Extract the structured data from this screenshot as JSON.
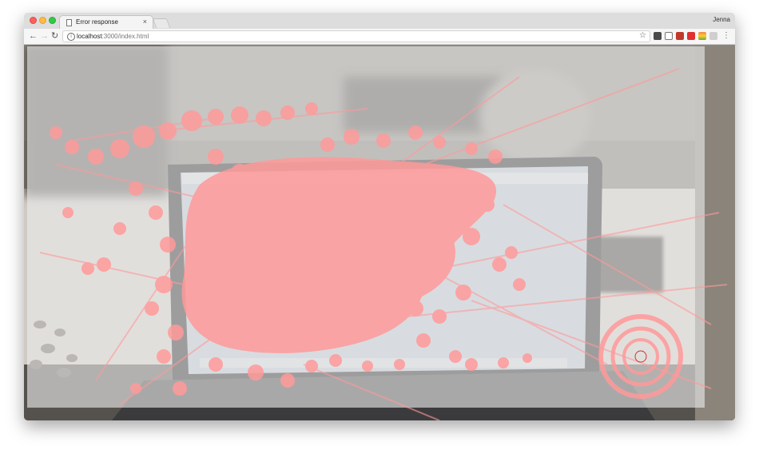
{
  "browser": {
    "tab_title": "Error response",
    "tab_close": "×",
    "profile_name": "Jenna",
    "url_host": "localhost",
    "url_path": ":3000/index.html",
    "nav": {
      "back": "←",
      "forward": "→",
      "reload": "↻"
    },
    "star": "☆",
    "menu": "⋮",
    "extension_icons": [
      "evernote-icon",
      "bookmark-icon",
      "shield-icon",
      "pdf-icon",
      "color-icon",
      "extension-icon"
    ]
  },
  "colors": {
    "gaze_overlay": "#ff9a9a",
    "target_ring": "#ff9999",
    "target_center": "#cc3333",
    "frost_overlay": "#ececec"
  },
  "overlay": {
    "content": "webcam video frame of a laptop with an eye-gaze heatmap overlay and a concentric-ring gaze target"
  }
}
